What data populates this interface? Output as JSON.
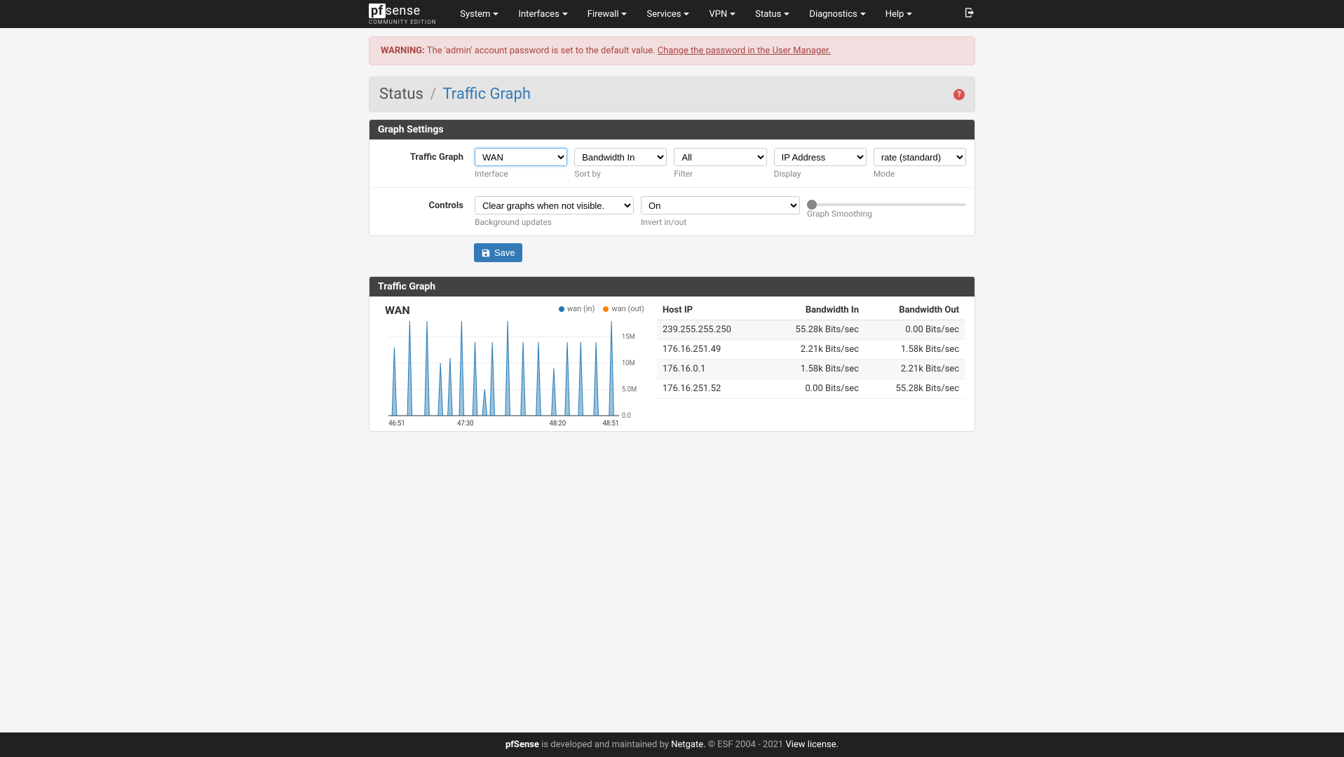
{
  "brand": {
    "prefix": "pf",
    "name": "sense",
    "sub": "COMMUNITY EDITION"
  },
  "nav": {
    "items": [
      "System",
      "Interfaces",
      "Firewall",
      "Services",
      "VPN",
      "Status",
      "Diagnostics",
      "Help"
    ]
  },
  "alert": {
    "label": "WARNING:",
    "text": " The 'admin' account password is set to the default value. ",
    "link": "Change the password in the User Manager."
  },
  "breadcrumb": {
    "root": "Status",
    "page": "Traffic Graph"
  },
  "panels": {
    "settings": "Graph Settings",
    "graph": "Traffic Graph"
  },
  "form": {
    "row1": {
      "label": "Traffic Graph",
      "interface": {
        "value": "WAN",
        "help": "Interface"
      },
      "sort": {
        "value": "Bandwidth In",
        "help": "Sort by"
      },
      "filter": {
        "value": "All",
        "help": "Filter"
      },
      "display": {
        "value": "IP Address",
        "help": "Display"
      },
      "mode": {
        "value": "rate (standard)",
        "help": "Mode"
      }
    },
    "row2": {
      "label": "Controls",
      "bg": {
        "value": "Clear graphs when not visible.",
        "help": "Background updates"
      },
      "invert": {
        "value": "On",
        "help": "Invert in/out"
      },
      "smoothing": {
        "help": "Graph Smoothing"
      }
    },
    "save": "Save"
  },
  "chart_data": {
    "type": "line",
    "title": "WAN",
    "series": [
      {
        "name": "wan (in)",
        "color": "#1f77b4"
      },
      {
        "name": "wan (out)",
        "color": "#ff7f0e"
      }
    ],
    "x_ticks": [
      "46:51",
      "47:30",
      "48:20",
      "48:51"
    ],
    "y_ticks": [
      "0.0",
      "5.0M",
      "10M",
      "15M"
    ],
    "ylim": [
      0,
      18000000
    ],
    "xrange": [
      0,
      120
    ],
    "in_spikes": [
      {
        "x": 3,
        "y": 13
      },
      {
        "x": 11,
        "y": 18
      },
      {
        "x": 20,
        "y": 18
      },
      {
        "x": 27,
        "y": 10
      },
      {
        "x": 32,
        "y": 11
      },
      {
        "x": 38,
        "y": 18
      },
      {
        "x": 45,
        "y": 14
      },
      {
        "x": 50,
        "y": 5
      },
      {
        "x": 54,
        "y": 14
      },
      {
        "x": 62,
        "y": 18
      },
      {
        "x": 70,
        "y": 14
      },
      {
        "x": 78,
        "y": 14
      },
      {
        "x": 86,
        "y": 9
      },
      {
        "x": 93,
        "y": 14
      },
      {
        "x": 100,
        "y": 14
      },
      {
        "x": 108,
        "y": 14
      },
      {
        "x": 116,
        "y": 18
      }
    ]
  },
  "table": {
    "headers": [
      "Host IP",
      "Bandwidth In",
      "Bandwidth Out"
    ],
    "rows": [
      {
        "ip": "239.255.255.250",
        "in": "55.28k Bits/sec",
        "out": "0.00 Bits/sec"
      },
      {
        "ip": "176.16.251.49",
        "in": "2.21k Bits/sec",
        "out": "1.58k Bits/sec"
      },
      {
        "ip": "176.16.0.1",
        "in": "1.58k Bits/sec",
        "out": "2.21k Bits/sec"
      },
      {
        "ip": "176.16.251.52",
        "in": "0.00 Bits/sec",
        "out": "55.28k Bits/sec"
      }
    ]
  },
  "footer": {
    "brand": "pfSense",
    "text1": " is developed and maintained by ",
    "netgate": "Netgate.",
    "text2": " © ESF 2004 - 2021 ",
    "license": "View license."
  }
}
